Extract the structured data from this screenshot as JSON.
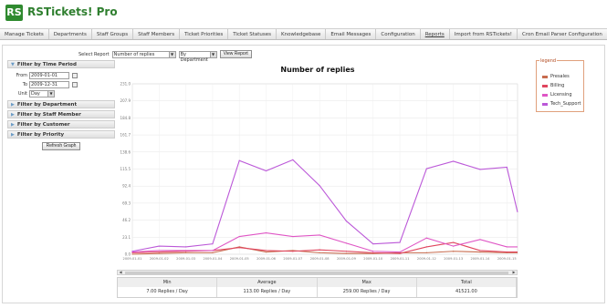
{
  "app": {
    "logo_mark": "RS",
    "title": "RSTickets! Pro"
  },
  "nav": [
    "Manage Tickets",
    "Departments",
    "Staff Groups",
    "Staff Members",
    "Ticket Priorities",
    "Ticket Statuses",
    "Knowledgebase",
    "Email Messages",
    "Configuration",
    "Reports",
    "Import from RSTickets!",
    "Cron Email Parser Configuration"
  ],
  "toolbar": {
    "select_report_label": "Select Report",
    "report_value": "Number of replies",
    "group_value": "By Department",
    "view_button": "View Report"
  },
  "filters": {
    "period_title": "Filter by Time Period",
    "from_label": "From",
    "from_value": "2009-01-01",
    "to_label": "To",
    "to_value": "2009-12-31",
    "unit_label": "Unit",
    "unit_value": "Day",
    "department": "Filter by Department",
    "staff": "Filter by Staff Member",
    "customer": "Filter by Customer",
    "priority": "Filter by Priority",
    "refresh_button": "Refresh Graph"
  },
  "legend": {
    "title": "legend",
    "items": [
      {
        "label": "Presales",
        "color": "#c86c4f"
      },
      {
        "label": "Billing",
        "color": "#e0455e"
      },
      {
        "label": "Licensing",
        "color": "#df56c5"
      },
      {
        "label": "Tech_Support",
        "color": "#bb58d8"
      }
    ]
  },
  "chart_data": {
    "type": "line",
    "title": "Number of replies",
    "categories": [
      "2009-01-01",
      "2009-01-02",
      "2009-01-03",
      "2009-01-04",
      "2009-01-05",
      "2009-01-06",
      "2009-01-07",
      "2009-01-08",
      "2009-01-09",
      "2009-01-10",
      "2009-01-11",
      "2009-01-12",
      "2009-01-13",
      "2009-01-14",
      "2009-01-15"
    ],
    "ylim": [
      0,
      231.0
    ],
    "y_ticks": [
      0.0,
      23.1,
      46.2,
      69.3,
      92.4,
      115.5,
      138.6,
      161.7,
      184.8,
      207.9,
      231.0
    ],
    "y_tick_labels": [
      "0.0",
      "23.1",
      "46.2",
      "69.3",
      "92.4",
      "115.5",
      "138.6",
      "161.7",
      "184.8",
      "207.9",
      "231.0"
    ],
    "x_tick_labels": [
      "2009-01-01",
      "2009-01-02",
      "2009-01-03",
      "2009-01-04",
      "2009-01-05",
      "2009-01-06",
      "2009-01-07",
      "2009-01-08",
      "2009-01-09",
      "2009-01-10",
      "2009-01-11",
      "2009-01-12",
      "2009-01-13",
      "2009-01-14",
      "2009-01-15"
    ],
    "grid": true,
    "series": [
      {
        "name": "Presales",
        "color": "#c86c4f",
        "values": [
          0,
          1,
          2,
          2,
          10,
          3,
          5,
          2,
          1,
          1,
          2,
          2,
          4,
          3,
          2
        ]
      },
      {
        "name": "Billing",
        "color": "#e0455e",
        "values": [
          2,
          3,
          4,
          5,
          9,
          5,
          4,
          6,
          4,
          2,
          1,
          10,
          16,
          5,
          3
        ]
      },
      {
        "name": "Licensing",
        "color": "#df56c5",
        "values": [
          3,
          5,
          5,
          5,
          24,
          29,
          24,
          26,
          15,
          4,
          3,
          22,
          11,
          20,
          10
        ]
      },
      {
        "name": "Tech_Support",
        "color": "#bb58d8",
        "values": [
          4,
          11,
          10,
          14,
          127,
          113,
          128,
          93,
          45,
          14,
          16,
          116,
          126,
          115,
          118
        ]
      }
    ],
    "extra_end_value_tech": 57
  },
  "stats": {
    "headers": [
      "Min",
      "Average",
      "Max",
      "Total"
    ],
    "values": [
      "7.00 Replies / Day",
      "113.00 Replies / Day",
      "259.00 Replies / Day",
      "41521.00"
    ]
  }
}
